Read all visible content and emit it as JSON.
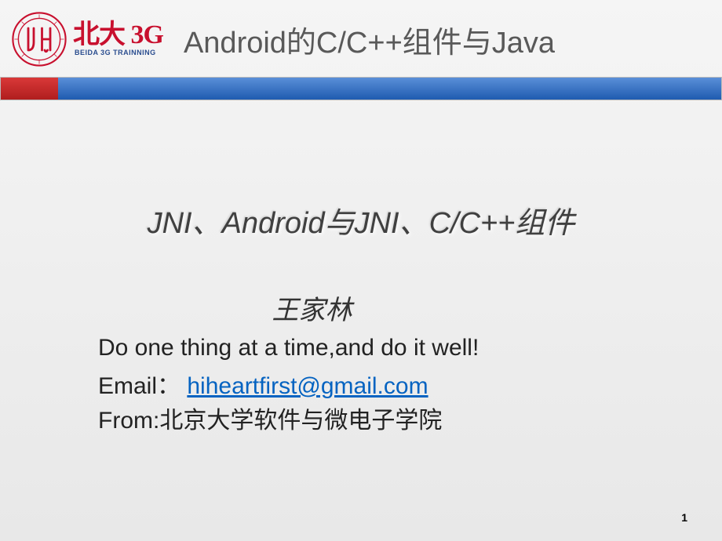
{
  "header": {
    "logo_main": "北大 3G",
    "logo_sub": "BEIDA 3G TRAINNING",
    "page_title": "Android的C/C++组件与Java"
  },
  "content": {
    "subtitle": "JNI、Android与JNI、C/C++组件",
    "author": "王家林",
    "motto": "Do one thing at a time,and do it well!",
    "email_label": "Email：",
    "email": "hiheartfirst@gmail.com",
    "from_label": "From:",
    "from_value": "北京大学软件与微电子学院"
  },
  "page_number": "1"
}
